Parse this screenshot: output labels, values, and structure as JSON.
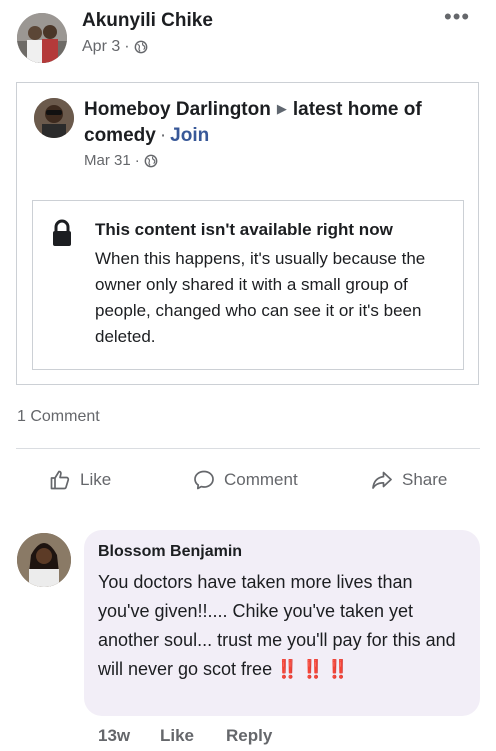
{
  "post": {
    "author": "Akunyili Chike",
    "date": "Apr 3",
    "dot": "·",
    "more": "•••"
  },
  "shared": {
    "author": "Homeboy Darlington",
    "group": "latest home of comedy",
    "dot": "·",
    "join_label": "Join",
    "date": "Mar 31",
    "date_dot": "·",
    "unavailable_title": "This content isn't available right now",
    "unavailable_body": "When this happens, it's usually because the owner only shared it with a small group of people, changed who can see it or it's been deleted."
  },
  "stats": {
    "comment_count": "1 Comment"
  },
  "actions": {
    "like": "Like",
    "comment": "Comment",
    "share": "Share"
  },
  "comment": {
    "author": "Blossom Benjamin",
    "text": "You doctors have taken more lives than you've given!!.... Chike you've taken yet another soul... trust me you'll pay for this and will never go scot free",
    "emoji": "‼️ ‼️ ‼️",
    "time": "13w",
    "like": "Like",
    "reply": "Reply"
  },
  "colors": {
    "link": "#385898",
    "meta": "#65676b",
    "bubble": "#f2eef7",
    "emoji_red": "#e02424"
  },
  "icons": [
    "globe-icon",
    "more-icon",
    "play-arrow-icon",
    "lock-icon",
    "like-icon",
    "comment-icon",
    "share-icon"
  ]
}
